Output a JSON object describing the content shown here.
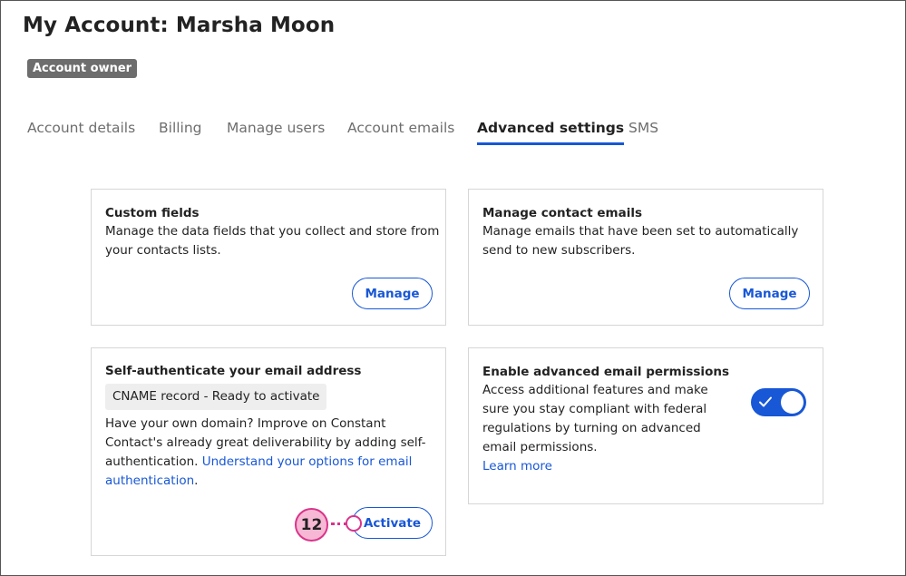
{
  "header": {
    "title": "My Account: Marsha Moon",
    "badge": "Account owner"
  },
  "tabs": [
    {
      "label": "Account details",
      "active": false
    },
    {
      "label": "Billing",
      "active": false
    },
    {
      "label": "Manage users",
      "active": false
    },
    {
      "label": "Account emails",
      "active": false
    },
    {
      "label": "Advanced settings",
      "active": true
    },
    {
      "label": "SMS",
      "active": false
    }
  ],
  "cards": {
    "custom_fields": {
      "title": "Custom fields",
      "description": "Manage the data fields that you collect and store from your contacts lists.",
      "button": "Manage"
    },
    "manage_contact_emails": {
      "title": "Manage contact emails",
      "description": "Manage emails that have been set to automatically send to new subscribers.",
      "button": "Manage"
    },
    "self_auth": {
      "title": "Self-authenticate your email address",
      "status": "CNAME record - Ready to activate",
      "description": "Have your own domain? Improve on Constant Contact's already great deliverability by adding self-authentication.",
      "link": "Understand your options for email authentication",
      "after_link": ".",
      "button": "Activate"
    },
    "advanced_permissions": {
      "title": "Enable advanced email permissions",
      "description": "Access additional features and make sure you stay compliant with federal regulations by turning on advanced email permissions.",
      "link": "Learn more",
      "toggle_on": true
    }
  },
  "annotation": {
    "step": "12"
  },
  "colors": {
    "accent": "#1857d6",
    "badge_bg": "#6d6d6d",
    "annotation_pink": "#d9348a"
  }
}
